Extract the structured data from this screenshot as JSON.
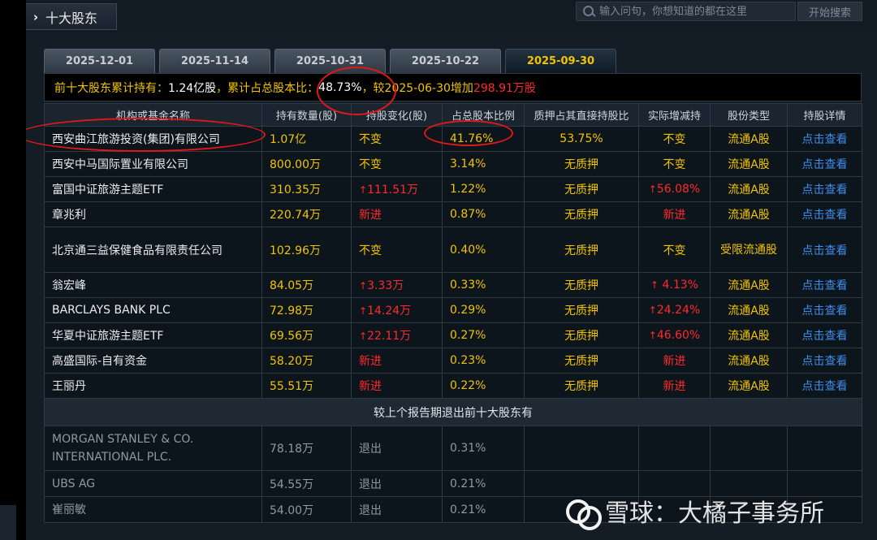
{
  "header": {
    "title": "十大股东",
    "search_placeholder": "输入问句，你想知道的都在这里",
    "search_button": "开始搜索"
  },
  "tabs": [
    "2025-12-01",
    "2025-11-14",
    "2025-10-31",
    "2025-10-22",
    "2025-09-30"
  ],
  "active_tab": "2025-09-30",
  "summary": {
    "p1": "前十大股东累计持有：",
    "v1": "1.24亿股",
    "p2": "，累计占总股本比：",
    "v2": "48.73%",
    "p3": "，较2025-06-30增加",
    "v3": "298.91万股"
  },
  "columns": [
    "机构或基金名称",
    "持有数量(股)",
    "持股变化(股)",
    "占总股本比例",
    "质押占其直接持股比",
    "实际增减持",
    "股份类型",
    "持股详情"
  ],
  "rows": [
    {
      "name": "西安曲江旅游投资(集团)有限公司",
      "qty": "1.07亿",
      "change": "不变",
      "change_up": false,
      "ratio": "41.76%",
      "pledge": "53.75%",
      "actual": "不变",
      "actual_up": false,
      "type": "流通A股",
      "detail": "点击查看"
    },
    {
      "name": "西安中马国际置业有限公司",
      "qty": "800.00万",
      "change": "不变",
      "change_up": false,
      "ratio": "3.14%",
      "pledge": "无质押",
      "actual": "不变",
      "actual_up": false,
      "type": "流通A股",
      "detail": "点击查看"
    },
    {
      "name": "富国中证旅游主题ETF",
      "qty": "310.35万",
      "change": "111.51万",
      "change_up": true,
      "ratio": "1.22%",
      "pledge": "无质押",
      "actual": "56.08%",
      "actual_up": true,
      "type": "流通A股",
      "detail": "点击查看"
    },
    {
      "name": "章兆利",
      "qty": "220.74万",
      "change": "新进",
      "change_up": false,
      "ratio": "0.87%",
      "pledge": "无质押",
      "actual": "新进",
      "actual_up": false,
      "type": "流通A股",
      "detail": "点击查看"
    },
    {
      "name": "北京通三益保健食品有限责任公司",
      "qty": "102.96万",
      "change": "不变",
      "change_up": false,
      "ratio": "0.40%",
      "pledge": "无质押",
      "actual": "不变",
      "actual_up": false,
      "type": "受限流通股",
      "detail": "点击查看"
    },
    {
      "name": "翁宏峰",
      "qty": "84.05万",
      "change": "3.33万",
      "change_up": true,
      "ratio": "0.33%",
      "pledge": "无质押",
      "actual": " 4.13%",
      "actual_up": true,
      "type": "流通A股",
      "detail": "点击查看"
    },
    {
      "name": "BARCLAYS BANK PLC",
      "qty": "72.98万",
      "change": "14.24万",
      "change_up": true,
      "ratio": "0.29%",
      "pledge": "无质押",
      "actual": "24.24%",
      "actual_up": true,
      "type": "流通A股",
      "detail": "点击查看"
    },
    {
      "name": "华夏中证旅游主题ETF",
      "qty": "69.56万",
      "change": "22.11万",
      "change_up": true,
      "ratio": "0.27%",
      "pledge": "无质押",
      "actual": "46.60%",
      "actual_up": true,
      "type": "流通A股",
      "detail": "点击查看"
    },
    {
      "name": "高盛国际-自有资金",
      "qty": "58.20万",
      "change": "新进",
      "change_up": false,
      "ratio": "0.23%",
      "pledge": "无质押",
      "actual": "新进",
      "actual_up": false,
      "type": "流通A股",
      "detail": "点击查看"
    },
    {
      "name": "王丽丹",
      "qty": "55.51万",
      "change": "新进",
      "change_up": false,
      "ratio": "0.22%",
      "pledge": "无质押",
      "actual": "新进",
      "actual_up": false,
      "type": "流通A股",
      "detail": "点击查看"
    }
  ],
  "exit_header": "较上个报告期退出前十大股东有",
  "exited": [
    {
      "name": "MORGAN STANLEY & CO. INTERNATIONAL PLC.",
      "qty": "78.18万",
      "change": "退出",
      "ratio": "0.31%"
    },
    {
      "name": "UBS AG",
      "qty": "54.55万",
      "change": "退出",
      "ratio": "0.21%"
    },
    {
      "name": "崔丽敏",
      "qty": "54.00万",
      "change": "退出",
      "ratio": "0.21%"
    }
  ],
  "watermark": "雪球：大橘子事务所",
  "colors": {
    "accent_yellow": "#f2c400",
    "increase_red": "#ff2a2a",
    "link_blue": "#3f8ee8",
    "annotation_red": "#e01818"
  }
}
